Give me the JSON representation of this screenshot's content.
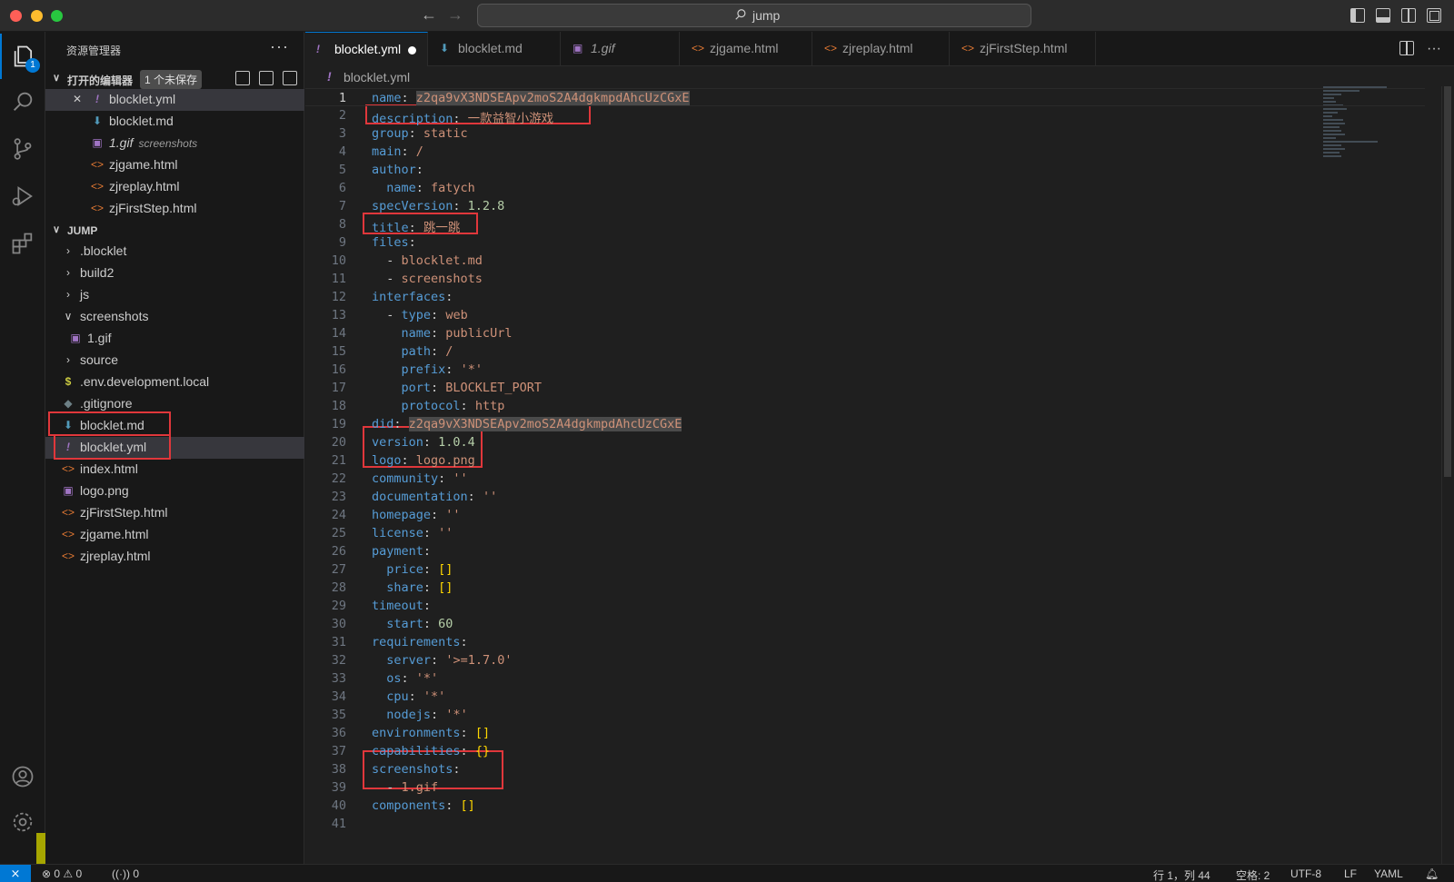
{
  "titlebar": {
    "search_text": "jump"
  },
  "activity": {
    "explorer_badge": "1"
  },
  "sidebar": {
    "header": "资源管理器",
    "more": "···",
    "open_editors": {
      "label": "打开的编辑器",
      "unsaved_badge": "1 个未保存",
      "items": [
        {
          "name": "blocklet.yml",
          "icon": "yml",
          "desc": ""
        },
        {
          "name": "blocklet.md",
          "icon": "md",
          "desc": ""
        },
        {
          "name": "1.gif",
          "icon": "img",
          "desc": "screenshots"
        },
        {
          "name": "zjgame.html",
          "icon": "html",
          "desc": ""
        },
        {
          "name": "zjreplay.html",
          "icon": "html",
          "desc": ""
        },
        {
          "name": "zjFirstStep.html",
          "icon": "html",
          "desc": ""
        }
      ]
    },
    "workspace": {
      "label": "JUMP",
      "items": [
        {
          "name": ".blocklet",
          "type": "folder"
        },
        {
          "name": "build2",
          "type": "folder"
        },
        {
          "name": "js",
          "type": "folder"
        },
        {
          "name": "screenshots",
          "type": "folder-open"
        },
        {
          "name": "1.gif",
          "type": "img"
        },
        {
          "name": "source",
          "type": "folder"
        },
        {
          "name": ".env.development.local",
          "type": "env"
        },
        {
          "name": ".gitignore",
          "type": "git"
        },
        {
          "name": "blocklet.md",
          "type": "md"
        },
        {
          "name": "blocklet.yml",
          "type": "yml"
        },
        {
          "name": "index.html",
          "type": "html"
        },
        {
          "name": "logo.png",
          "type": "img"
        },
        {
          "name": "zjFirstStep.html",
          "type": "html"
        },
        {
          "name": "zjgame.html",
          "type": "html"
        },
        {
          "name": "zjreplay.html",
          "type": "html"
        }
      ]
    }
  },
  "tabs": [
    {
      "name": "blocklet.yml",
      "icon": "yml",
      "active": true,
      "dirty": true
    },
    {
      "name": "blocklet.md",
      "icon": "md"
    },
    {
      "name": "1.gif",
      "icon": "img"
    },
    {
      "name": "zjgame.html",
      "icon": "html"
    },
    {
      "name": "zjreplay.html",
      "icon": "html"
    },
    {
      "name": "zjFirstStep.html",
      "icon": "html"
    }
  ],
  "breadcrumb": {
    "file": "blocklet.yml"
  },
  "editor": {
    "lines": [
      "name: z2qa9vX3NDSEApv2moS2A4dgkmpdAhcUzCGxE",
      "description: 一款益智小游戏",
      "group: static",
      "main: /",
      "author:",
      "  name: fatych",
      "specVersion: 1.2.8",
      "title: 跳一跳",
      "files:",
      "  - blocklet.md",
      "  - screenshots",
      "interfaces:",
      "  - type: web",
      "    name: publicUrl",
      "    path: /",
      "    prefix: '*'",
      "    port: BLOCKLET_PORT",
      "    protocol: http",
      "did: z2qa9vX3NDSEApv2moS2A4dgkmpdAhcUzCGxE",
      "version: 1.0.4",
      "logo: logo.png",
      "community: ''",
      "documentation: ''",
      "homepage: ''",
      "license: ''",
      "payment:",
      "  price: []",
      "  share: []",
      "timeout:",
      "  start: 60",
      "requirements:",
      "  server: '>=1.7.0'",
      "  os: '*'",
      "  cpu: '*'",
      "  nodejs: '*'",
      "environments: []",
      "capabilities: {}",
      "screenshots:",
      "  - 1.gif",
      "components: []",
      ""
    ]
  },
  "statusbar": {
    "errors": "0",
    "warnings": "0",
    "ports": "0",
    "cursor": "行 1，列 44",
    "indent": "空格: 2",
    "encoding": "UTF-8",
    "eol": "LF",
    "language": "YAML"
  }
}
